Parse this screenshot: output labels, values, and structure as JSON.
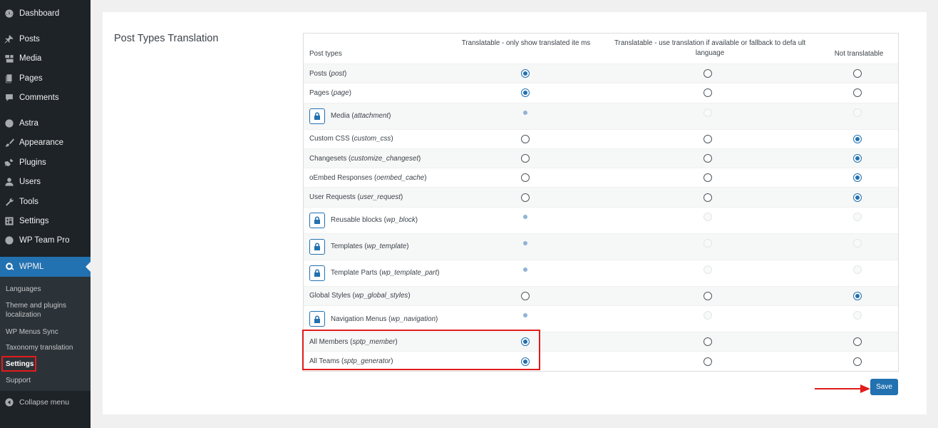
{
  "sidebar": {
    "items": [
      {
        "label": "Dashboard",
        "icon": "dashboard-icon"
      },
      {
        "label": "Posts",
        "icon": "pin-icon"
      },
      {
        "label": "Media",
        "icon": "media-icon"
      },
      {
        "label": "Pages",
        "icon": "pages-icon"
      },
      {
        "label": "Comments",
        "icon": "comment-icon"
      },
      {
        "label": "Astra",
        "icon": "astra-icon"
      },
      {
        "label": "Appearance",
        "icon": "brush-icon"
      },
      {
        "label": "Plugins",
        "icon": "plug-icon"
      },
      {
        "label": "Users",
        "icon": "user-icon"
      },
      {
        "label": "Tools",
        "icon": "wrench-icon"
      },
      {
        "label": "Settings",
        "icon": "settings-icon"
      },
      {
        "label": "WP Team Pro",
        "icon": "team-icon"
      },
      {
        "label": "WPML",
        "icon": "wpml-icon"
      }
    ],
    "submenu": [
      "Languages",
      "Theme and plugins localization",
      "WP Menus Sync",
      "Taxonomy translation",
      "Settings",
      "Support"
    ],
    "collapse_label": "Collapse menu"
  },
  "section_title": "Post Types Translation",
  "table": {
    "headers": {
      "col0": "Post types",
      "col1": "Translatable - only show translated ite ms",
      "col2": "Translatable - use translation if available or fallback to defa ult language",
      "col3": "Not translatable"
    },
    "rows": [
      {
        "name": "Posts",
        "slug": "post",
        "locked": false,
        "selected": 1
      },
      {
        "name": "Pages",
        "slug": "page",
        "locked": false,
        "selected": 1
      },
      {
        "name": "Media",
        "slug": "attachment",
        "locked": true,
        "selected": 1
      },
      {
        "name": "Custom CSS",
        "slug": "custom_css",
        "locked": false,
        "selected": 3
      },
      {
        "name": "Changesets",
        "slug": "customize_changeset",
        "locked": false,
        "selected": 3
      },
      {
        "name": "oEmbed Responses",
        "slug": "oembed_cache",
        "locked": false,
        "selected": 3
      },
      {
        "name": "User Requests",
        "slug": "user_request",
        "locked": false,
        "selected": 3
      },
      {
        "name": "Reusable blocks",
        "slug": "wp_block",
        "locked": true,
        "selected": 1
      },
      {
        "name": "Templates",
        "slug": "wp_template",
        "locked": true,
        "selected": 1
      },
      {
        "name": "Template Parts",
        "slug": "wp_template_part",
        "locked": true,
        "selected": 1
      },
      {
        "name": "Global Styles",
        "slug": "wp_global_styles",
        "locked": false,
        "selected": 3
      },
      {
        "name": "Navigation Menus",
        "slug": "wp_navigation",
        "locked": true,
        "selected": 1
      },
      {
        "name": "All Members",
        "slug": "sptp_member",
        "locked": false,
        "selected": 1
      },
      {
        "name": "All Teams",
        "slug": "sptp_generator",
        "locked": false,
        "selected": 1
      }
    ]
  },
  "save_label": "Save",
  "colors": {
    "accent": "#2271b1",
    "sidebar": "#1d2327",
    "highlight": "#e21b1b"
  }
}
